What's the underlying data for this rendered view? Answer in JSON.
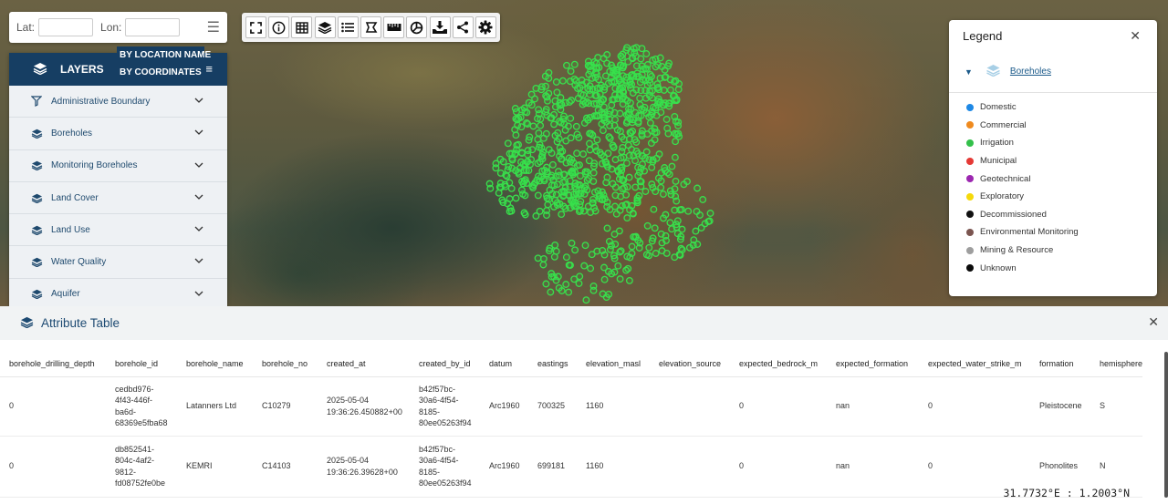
{
  "coord_search": {
    "lat_label": "Lat:",
    "lon_label": "Lon:",
    "lat_value": "",
    "lon_value": "",
    "menu_icon": "hamburger-menu-icon"
  },
  "search_mode_menu": {
    "options": [
      "BY LOCATION NAME",
      "BY COORDINATES"
    ]
  },
  "layers_panel": {
    "title": "LAYERS",
    "items": [
      {
        "label": "Administrative Boundary",
        "icon": "boundary-icon"
      },
      {
        "label": "Boreholes",
        "icon": "layers-icon"
      },
      {
        "label": "Monitoring Boreholes",
        "icon": "layers-icon"
      },
      {
        "label": "Land Cover",
        "icon": "layers-icon"
      },
      {
        "label": "Land Use",
        "icon": "layers-icon"
      },
      {
        "label": "Water Quality",
        "icon": "layers-icon"
      },
      {
        "label": "Aquifer",
        "icon": "layers-icon"
      }
    ]
  },
  "toolbar": {
    "tools": [
      "fullscreen-icon",
      "info-icon",
      "table-icon",
      "layers-icon",
      "list-icon",
      "draw-polygon-icon",
      "measure-ruler-icon",
      "chart-pie-icon",
      "download-icon",
      "share-icon",
      "settings-gear-icon"
    ]
  },
  "legend": {
    "title": "Legend",
    "layer_name": "Boreholes",
    "entries": [
      {
        "label": "Domestic",
        "color": "#1e88e5"
      },
      {
        "label": "Commercial",
        "color": "#ef8a1e"
      },
      {
        "label": "Irrigation",
        "color": "#33c04a"
      },
      {
        "label": "Municipal",
        "color": "#e53935"
      },
      {
        "label": "Geotechnical",
        "color": "#9c27b0"
      },
      {
        "label": "Exploratory",
        "color": "#f5d90a"
      },
      {
        "label": "Decommissioned",
        "color": "#111111"
      },
      {
        "label": "Environmental Monitoring",
        "color": "#7b5550"
      },
      {
        "label": "Mining & Resource",
        "color": "#9e9e9e"
      },
      {
        "label": "Unknown",
        "color": "#0a0a0a"
      }
    ]
  },
  "attribute_table": {
    "title": "Attribute Table",
    "columns": [
      "borehole_drilling_depth",
      "borehole_id",
      "borehole_name",
      "borehole_no",
      "created_at",
      "created_by_id",
      "datum",
      "eastings",
      "elevation_masl",
      "elevation_source",
      "expected_bedrock_m",
      "expected_formation",
      "expected_water_strike_m",
      "formation",
      "hemisphere"
    ],
    "rows": [
      [
        "0",
        "cedbd976-\n4f43-446f-\nba6d-\n68369e5fba68",
        "Latanners Ltd",
        "C10279",
        "2025-05-04\n19:36:26.450882+00",
        "b42f57bc-\n30a6-4f54-\n8185-\n80ee05263f94",
        "Arc1960",
        "700325",
        "1160",
        "",
        "0",
        "nan",
        "0",
        "Pleistocene",
        "S"
      ],
      [
        "0",
        "db852541-\n804c-4af2-\n9812-\nfd08752fe0be",
        "KEMRI",
        "C14103",
        "2025-05-04\n19:36:26.39628+00",
        "b42f57bc-\n30a6-4f54-\n8185-\n80ee05263f94",
        "Arc1960",
        "699181",
        "1160",
        "",
        "0",
        "nan",
        "0",
        "Phonolites",
        "N"
      ]
    ]
  },
  "coordinate_readout": "31.7732°E : 1.2003°N"
}
